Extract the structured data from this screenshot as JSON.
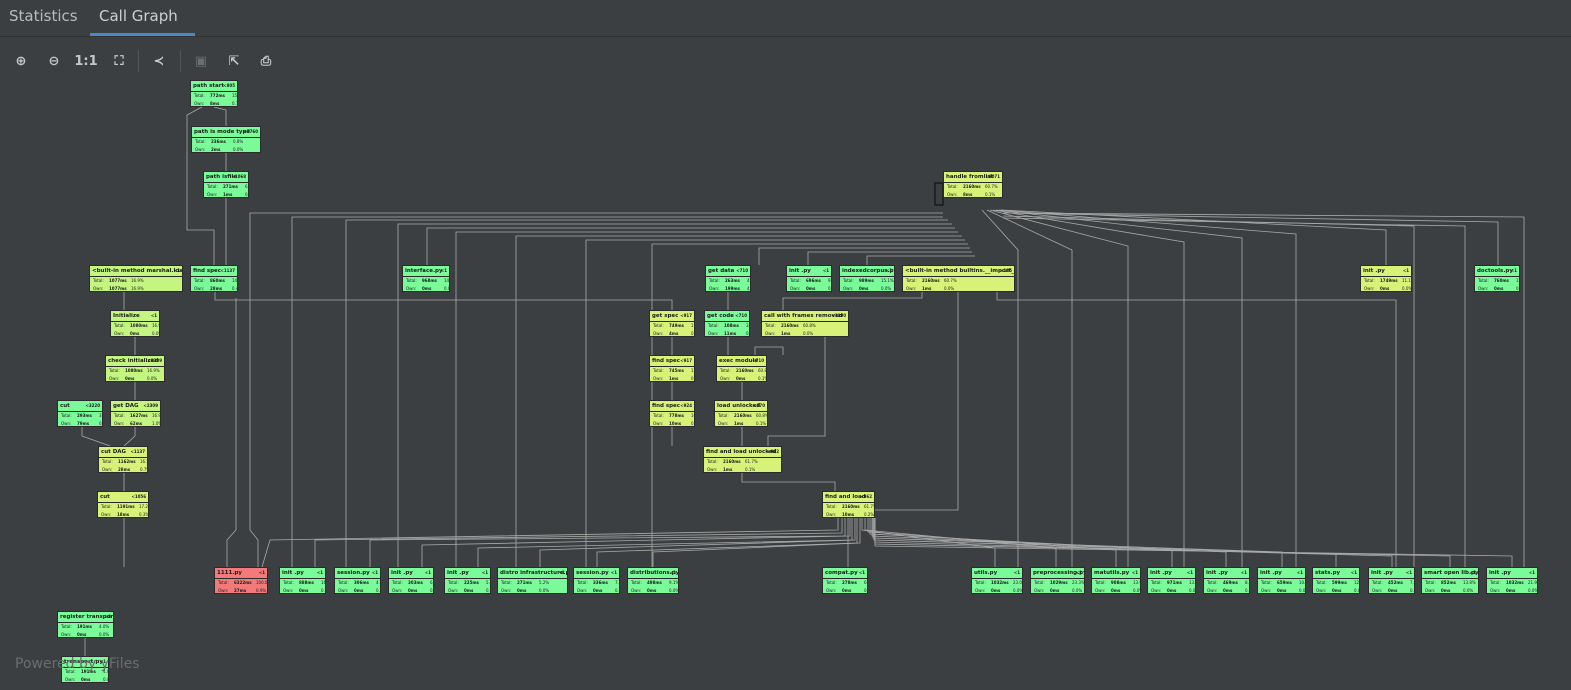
{
  "tabs": [
    {
      "label": "Statistics",
      "active": false
    },
    {
      "label": "Call Graph",
      "active": true
    }
  ],
  "toolbar": [
    {
      "name": "zoom-in-button",
      "icon": "zoom-in-icon",
      "glyph": "⊕"
    },
    {
      "name": "zoom-out-button",
      "icon": "zoom-out-icon",
      "glyph": "⊖"
    },
    {
      "name": "actual-size-button",
      "icon": "actual-size-icon",
      "glyph": "1:1"
    },
    {
      "name": "fit-content-button",
      "icon": "fit-content-icon",
      "glyph": "⛶"
    },
    {
      "name": "layout-button",
      "icon": "tree-layout-icon",
      "glyph": "≺"
    },
    {
      "name": "save-button",
      "icon": "save-icon",
      "glyph": "▣",
      "disabled": true
    },
    {
      "name": "export-button",
      "icon": "export-icon",
      "glyph": "⇱"
    },
    {
      "name": "print-button",
      "icon": "print-icon",
      "glyph": "⎙"
    }
  ],
  "colors": {
    "background": "#3c3f41",
    "accent": "#4a88c7",
    "green": "#7bfa9a",
    "yellow": "#d8f279",
    "lime": "#c3f580",
    "red": "#f27a7a"
  },
  "row_labels": {
    "total": "Total:",
    "own": "Own:"
  },
  "footer": {
    "text": "Powered by yFiles"
  },
  "nodes": [
    {
      "name": "path start",
      "count": "<805",
      "total": "772ms",
      "tpct": "15.8%",
      "own": "8ms",
      "opct": "0.1%",
      "color": "g"
    },
    {
      "name": "path is mode type",
      "count": "<7760",
      "total": "236ms",
      "tpct": "0.8%",
      "own": "2ms",
      "opct": "0.0%",
      "color": "g"
    },
    {
      "name": "path isfile",
      "count": "<1068",
      "total": "271ms",
      "tpct": "6.1%",
      "own": "1ms",
      "opct": "0.0%",
      "color": "g"
    },
    {
      "name": "handle fromlist",
      "count": "<8071",
      "total": "2160ms",
      "tpct": "60.7%",
      "own": "8ms",
      "opct": "0.1%",
      "color": "y"
    },
    {
      "name": "<built-in method marshal.loads>",
      "count": "<1",
      "total": "1077ms",
      "tpct": "16.9%",
      "own": "1077ms",
      "opct": "16.9%",
      "color": "l"
    },
    {
      "name": "find spec",
      "count": "<1137",
      "total": "860ms",
      "tpct": "14.7%",
      "own": "28ms",
      "opct": "0.4%",
      "color": "g"
    },
    {
      "name": "interface.py",
      "count": "<1",
      "total": "968ms",
      "tpct": "14.8%",
      "own": "0ms",
      "opct": "0.0%",
      "color": "g"
    },
    {
      "name": "get data",
      "count": "<710",
      "total": "263ms",
      "tpct": "4.6%",
      "own": "199ms",
      "opct": "4.6%",
      "color": "g"
    },
    {
      "name": "init .py",
      "count": "<1",
      "total": "696ms",
      "tpct": "9.7%",
      "own": "0ms",
      "opct": "0.0%",
      "color": "g"
    },
    {
      "name": "indexedcorpus.py",
      "count": "<1",
      "total": "989ms",
      "tpct": "15.1%",
      "own": "0ms",
      "opct": "0.0%",
      "color": "g"
    },
    {
      "name": "<built-in method builtins.__import__>",
      "count": "<185",
      "total": "2160ms",
      "tpct": "60.7%",
      "own": "1ms",
      "opct": "0.0%",
      "color": "y"
    },
    {
      "name": "init .py",
      "count": "<1",
      "total": "1749ms",
      "tpct": "11.1%",
      "own": "0ms",
      "opct": "0.0%",
      "color": "y"
    },
    {
      "name": "doctools.py",
      "count": "<1",
      "total": "760ms",
      "tpct": "1.1%",
      "own": "0ms",
      "opct": "0.0%",
      "color": "g"
    },
    {
      "name": "Initialize",
      "count": "<1",
      "total": "1080ms",
      "tpct": "16.9%",
      "own": "0ms",
      "opct": "0.0%",
      "color": "l"
    },
    {
      "name": "get spec",
      "count": "<917",
      "total": "749ms",
      "tpct": "17.7%",
      "own": "4ms",
      "opct": "0.1%",
      "color": "y"
    },
    {
      "name": "get code",
      "count": "<710",
      "total": "108ms",
      "tpct": "3.5%",
      "own": "11ms",
      "opct": "0.3%",
      "color": "g"
    },
    {
      "name": "call with frames removed",
      "count": "<1190",
      "total": "2160ms",
      "tpct": "60.8%",
      "own": "1ms",
      "opct": "0.0%",
      "color": "y"
    },
    {
      "name": "check initialized",
      "count": "<2309",
      "total": "1080ms",
      "tpct": "16.9%",
      "own": "0ms",
      "opct": "0.0%",
      "color": "l"
    },
    {
      "name": "find spec",
      "count": "<917",
      "total": "745ms",
      "tpct": "17.6%",
      "own": "1ms",
      "opct": "0.0%",
      "color": "y"
    },
    {
      "name": "exec module",
      "count": "<710",
      "total": "2160ms",
      "tpct": "60.8%",
      "own": "0ms",
      "opct": "0.1%",
      "color": "y"
    },
    {
      "name": "cut",
      "count": "<3220",
      "total": "293ms",
      "tpct": "3.7%",
      "own": "79ms",
      "opct": "0.1%",
      "color": "g"
    },
    {
      "name": "get DAG",
      "count": "<2309",
      "total": "1627ms",
      "tpct": "16.9%",
      "own": "62ms",
      "opct": "1.0%",
      "color": "l"
    },
    {
      "name": "find spec",
      "count": "<924",
      "total": "778ms",
      "tpct": "16.7%",
      "own": "10ms",
      "opct": "0.2%",
      "color": "y"
    },
    {
      "name": "load unlocked",
      "count": "<870",
      "total": "2160ms",
      "tpct": "60.8%",
      "own": "1ms",
      "opct": "0.1%",
      "color": "y"
    },
    {
      "name": "cut DAG",
      "count": "<1137",
      "total": "1162ms",
      "tpct": "16.5%",
      "own": "28ms",
      "opct": "0.7%",
      "color": "y"
    },
    {
      "name": "find and load unlocked",
      "count": "<962",
      "total": "2160ms",
      "tpct": "61.7%",
      "own": "1ms",
      "opct": "0.1%",
      "color": "y"
    },
    {
      "name": "cut",
      "count": "<1056",
      "total": "1191ms",
      "tpct": "17.2%",
      "own": "18ms",
      "opct": "0.3%",
      "color": "y"
    },
    {
      "name": "find and load",
      "count": "<962",
      "total": "2160ms",
      "tpct": "61.7%",
      "own": "10ms",
      "opct": "0.2%",
      "color": "y"
    },
    {
      "name": "1111.py",
      "count": "<1",
      "total": "6322ms",
      "tpct": "100.0%",
      "own": "27ms",
      "opct": "0.9%",
      "color": "r"
    },
    {
      "name": "init .py",
      "count": "<1",
      "total": "888ms",
      "tpct": "16.2%",
      "own": "0ms",
      "opct": "0.0%",
      "color": "g"
    },
    {
      "name": "session.py",
      "count": "<1",
      "total": "306ms",
      "tpct": "4.6%",
      "own": "0ms",
      "opct": "0.0%",
      "color": "g"
    },
    {
      "name": "init .py",
      "count": "<1",
      "total": "303ms",
      "tpct": "6.2%",
      "own": "0ms",
      "opct": "0.0%",
      "color": "g"
    },
    {
      "name": "init .py",
      "count": "<1",
      "total": "225ms",
      "tpct": "5.6%",
      "own": "0ms",
      "opct": "0.0%",
      "color": "g"
    },
    {
      "name": "distro infrastructure.py",
      "count": "<1",
      "total": "271ms",
      "tpct": "5.2%",
      "own": "0ms",
      "opct": "0.0%",
      "color": "g"
    },
    {
      "name": "session.py",
      "count": "<1",
      "total": "336ms",
      "tpct": "7.7%",
      "own": "0ms",
      "opct": "0.0%",
      "color": "g"
    },
    {
      "name": "distributions.py",
      "count": "<1",
      "total": "498ms",
      "tpct": "9.1%",
      "own": "0ms",
      "opct": "0.0%",
      "color": "g"
    },
    {
      "name": "compat.py",
      "count": "<1",
      "total": "278ms",
      "tpct": "6.0%",
      "own": "0ms",
      "opct": "0.0%",
      "color": "g"
    },
    {
      "name": "utils.py",
      "count": "<1",
      "total": "1032ms",
      "tpct": "23.0%",
      "own": "0ms",
      "opct": "0.0%",
      "color": "g"
    },
    {
      "name": "preprocessing.py",
      "count": "<1",
      "total": "1029ms",
      "tpct": "23.3%",
      "own": "0ms",
      "opct": "0.0%",
      "color": "g"
    },
    {
      "name": "matutils.py",
      "count": "<1",
      "total": "908ms",
      "tpct": "13.9%",
      "own": "0ms",
      "opct": "0.0%",
      "color": "g"
    },
    {
      "name": "init .py",
      "count": "<1",
      "total": "971ms",
      "tpct": "13.3%",
      "own": "0ms",
      "opct": "0.0%",
      "color": "g"
    },
    {
      "name": "init .py",
      "count": "<1",
      "total": "469ms",
      "tpct": "8.7%",
      "own": "0ms",
      "opct": "0.0%",
      "color": "g"
    },
    {
      "name": "init .py",
      "count": "<1",
      "total": "659ms",
      "tpct": "10.7%",
      "own": "0ms",
      "opct": "0.0%",
      "color": "g"
    },
    {
      "name": "stats.py",
      "count": "<1",
      "total": "599ms",
      "tpct": "12.7%",
      "own": "0ms",
      "opct": "0.0%",
      "color": "g"
    },
    {
      "name": "init .py",
      "count": "<1",
      "total": "452ms",
      "tpct": "7.7%",
      "own": "0ms",
      "opct": "0.0%",
      "color": "g"
    },
    {
      "name": "smart open lib.py",
      "count": "<1",
      "total": "852ms",
      "tpct": "13.8%",
      "own": "0ms",
      "opct": "0.0%",
      "color": "g"
    },
    {
      "name": "init .py",
      "count": "<1",
      "total": "1032ms",
      "tpct": "21.9%",
      "own": "0ms",
      "opct": "0.0%",
      "color": "g"
    },
    {
      "name": "register transport",
      "count": "<8",
      "total": "191ms",
      "tpct": "4.0%",
      "own": "0ms",
      "opct": "0.0%",
      "color": "g"
    },
    {
      "name": "transport.py",
      "count": "<1",
      "total": "191ms",
      "tpct": "4.0%",
      "own": "0ms",
      "opct": "0.0%",
      "color": "g"
    }
  ]
}
